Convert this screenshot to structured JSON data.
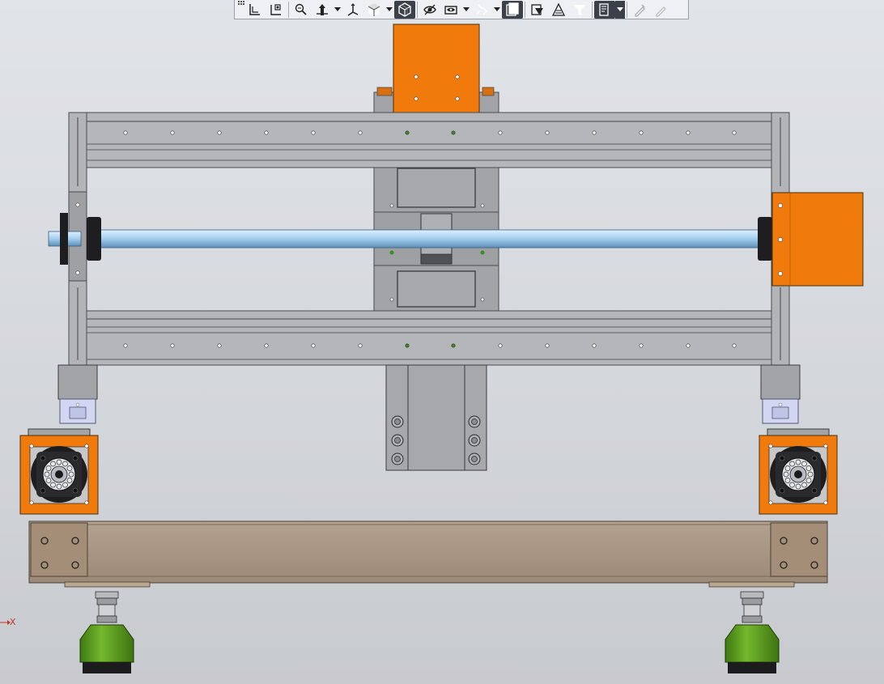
{
  "toolbar": {
    "items": [
      {
        "name": "view-grip-icon",
        "type": "grip"
      },
      {
        "name": "zoom-to-fit-icon",
        "type": "btn"
      },
      {
        "name": "zoom-to-area-icon",
        "type": "btn"
      },
      {
        "name": "previous-view-icon",
        "type": "btn"
      },
      {
        "name": "section-view-icon",
        "type": "btn",
        "dropdown": true
      },
      {
        "name": "dynamic-annotation-icon",
        "type": "btn"
      },
      {
        "name": "view-orientation-icon",
        "type": "btn",
        "dropdown": true
      },
      {
        "name": "display-style-icon",
        "type": "btn",
        "active": true
      },
      {
        "name": "shaded-edges-icon",
        "type": "btn"
      },
      {
        "name": "hide-show-items-icon",
        "type": "btn",
        "dropdown": true
      },
      {
        "name": "edit-appearance-icon",
        "type": "btn",
        "dropdown": true
      },
      {
        "name": "apply-scene-icon",
        "type": "btn",
        "active": true
      },
      {
        "name": "view-settings-icon",
        "type": "btn"
      },
      {
        "name": "realview-icon",
        "type": "btn"
      },
      {
        "name": "shadows-icon",
        "type": "btn"
      },
      {
        "name": "selection-filter-icon",
        "type": "btn",
        "active": true,
        "dropdown": true
      },
      {
        "name": "view-palette-icon",
        "type": "btn"
      },
      {
        "name": "measure-icon",
        "type": "btn",
        "disabled": true
      }
    ]
  },
  "triad": {
    "axis_label": "X"
  },
  "colors": {
    "frame": "#b4b6ba",
    "frame_dark": "#5a5c60",
    "orange": "#f07a0c",
    "shaft": "#a8d2f2",
    "base": "#a89684",
    "foot_green": "#5e9e22",
    "rail_guide": "#d2d6f0"
  }
}
